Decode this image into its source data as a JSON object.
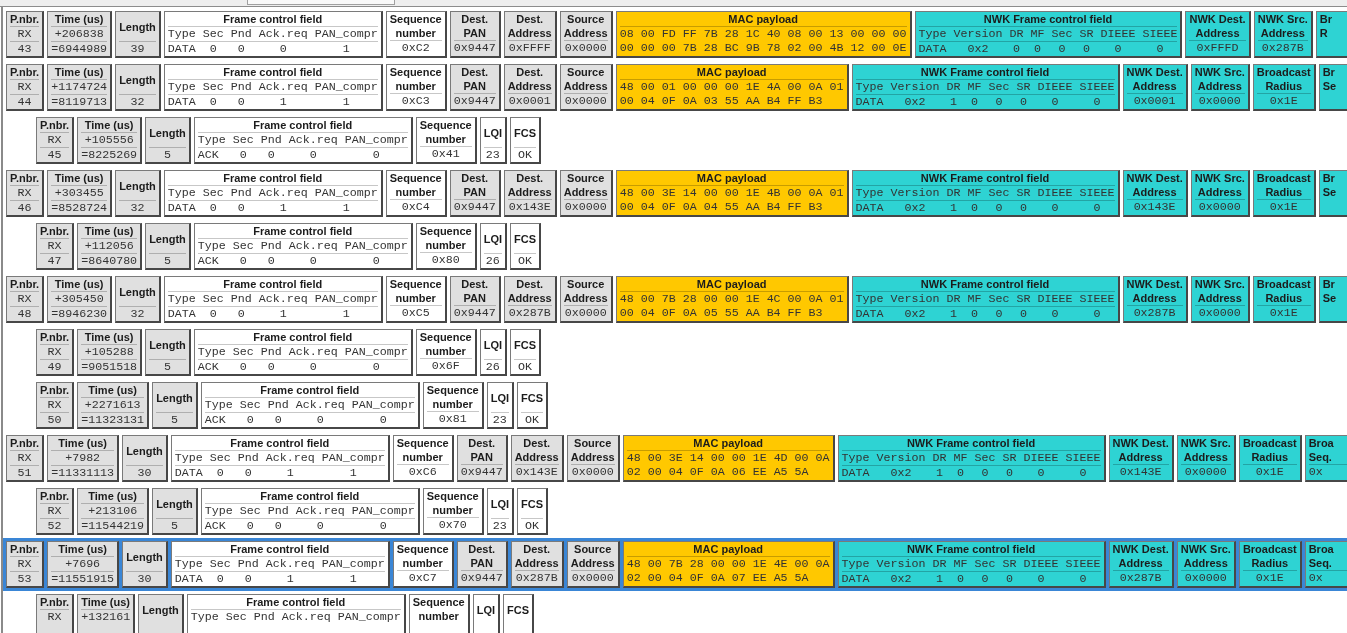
{
  "packets": [
    {
      "kind": "data",
      "selected": false,
      "fields": [
        {
          "kind": "stack",
          "color": "#e0e0e0",
          "label": [
            "P.nbr."
          ],
          "values": [
            "RX",
            "43"
          ]
        },
        {
          "kind": "stack",
          "color": "#e0e0e0",
          "label": [
            "Time (us)"
          ],
          "values": [
            "+206838",
            "=6944989"
          ]
        },
        {
          "kind": "tall",
          "color": "#e0e0e0",
          "label": [
            "Length"
          ],
          "values": [
            "39"
          ]
        },
        {
          "kind": "bits",
          "color": "#ffffff",
          "label": [
            "Frame control field"
          ],
          "bits": [
            {
              "name": "Type",
              "value": "DATA"
            },
            {
              "name": "Sec",
              "value": "0"
            },
            {
              "name": "Pnd",
              "value": "0"
            },
            {
              "name": "Ack.req",
              "value": "0"
            },
            {
              "name": "PAN_compr",
              "value": "1"
            }
          ]
        },
        {
          "kind": "stack",
          "color": "#ffffff",
          "label": [
            "Sequence",
            "number"
          ],
          "values": [
            "0xC2"
          ]
        },
        {
          "kind": "stack",
          "color": "#e0e0e0",
          "label": [
            "Dest.",
            "PAN"
          ],
          "values": [
            "0x9447"
          ]
        },
        {
          "kind": "stack",
          "color": "#e0e0e0",
          "label": [
            "Dest.",
            "Address"
          ],
          "values": [
            "0xFFFF"
          ]
        },
        {
          "kind": "stack",
          "color": "#e0e0e0",
          "label": [
            "Source",
            "Address"
          ],
          "values": [
            "0x0000"
          ]
        },
        {
          "kind": "payload",
          "color": "#ffc800",
          "label": [
            "MAC payload"
          ],
          "values": [
            "08 00 FD FF 7B 28 1C 40 08 00 13 00 00 00",
            "00 00 00 7B 28 BC 9B 78 02 00 4B 12 00 0E"
          ]
        },
        {
          "kind": "bits",
          "color": "#2ed3d3",
          "label": [
            "NWK Frame control field"
          ],
          "bits": [
            {
              "name": "Type",
              "value": "DATA"
            },
            {
              "name": "Version",
              "value": "0x2"
            },
            {
              "name": "DR",
              "value": "0"
            },
            {
              "name": "MF",
              "value": "0"
            },
            {
              "name": "Sec",
              "value": "0"
            },
            {
              "name": "SR",
              "value": "0"
            },
            {
              "name": "DIEEE",
              "value": "0"
            },
            {
              "name": "SIEEE",
              "value": "0"
            }
          ]
        },
        {
          "kind": "stack",
          "color": "#2ed3d3",
          "label": [
            "NWK Dest.",
            "Address"
          ],
          "values": [
            "0xFFFD"
          ]
        },
        {
          "kind": "stack",
          "color": "#2ed3d3",
          "label": [
            "NWK Src.",
            "Address"
          ],
          "values": [
            "0x287B"
          ]
        },
        {
          "kind": "partial",
          "color": "#2ed3d3",
          "label": [
            "Br",
            "R"
          ]
        }
      ]
    },
    {
      "kind": "data",
      "selected": false,
      "fields": [
        {
          "kind": "stack",
          "color": "#e0e0e0",
          "label": [
            "P.nbr."
          ],
          "values": [
            "RX",
            "44"
          ]
        },
        {
          "kind": "stack",
          "color": "#e0e0e0",
          "label": [
            "Time (us)"
          ],
          "values": [
            "+1174724",
            "=8119713"
          ]
        },
        {
          "kind": "tall",
          "color": "#e0e0e0",
          "label": [
            "Length"
          ],
          "values": [
            "32"
          ]
        },
        {
          "kind": "bits",
          "color": "#ffffff",
          "label": [
            "Frame control field"
          ],
          "bits": [
            {
              "name": "Type",
              "value": "DATA"
            },
            {
              "name": "Sec",
              "value": "0"
            },
            {
              "name": "Pnd",
              "value": "0"
            },
            {
              "name": "Ack.req",
              "value": "1"
            },
            {
              "name": "PAN_compr",
              "value": "1"
            }
          ]
        },
        {
          "kind": "stack",
          "color": "#ffffff",
          "label": [
            "Sequence",
            "number"
          ],
          "values": [
            "0xC3"
          ]
        },
        {
          "kind": "stack",
          "color": "#e0e0e0",
          "label": [
            "Dest.",
            "PAN"
          ],
          "values": [
            "0x9447"
          ]
        },
        {
          "kind": "stack",
          "color": "#e0e0e0",
          "label": [
            "Dest.",
            "Address"
          ],
          "values": [
            "0x0001"
          ]
        },
        {
          "kind": "stack",
          "color": "#e0e0e0",
          "label": [
            "Source",
            "Address"
          ],
          "values": [
            "0x0000"
          ]
        },
        {
          "kind": "payload",
          "color": "#ffc800",
          "label": [
            "MAC payload"
          ],
          "values": [
            "48 00 01 00 00 00 1E 4A 00 0A 01",
            "00 04 0F 0A 03 55 AA B4 FF B3"
          ]
        },
        {
          "kind": "bits",
          "color": "#2ed3d3",
          "label": [
            "NWK Frame control field"
          ],
          "bits": [
            {
              "name": "Type",
              "value": "DATA"
            },
            {
              "name": "Version",
              "value": "0x2"
            },
            {
              "name": "DR",
              "value": "1"
            },
            {
              "name": "MF",
              "value": "0"
            },
            {
              "name": "Sec",
              "value": "0"
            },
            {
              "name": "SR",
              "value": "0"
            },
            {
              "name": "DIEEE",
              "value": "0"
            },
            {
              "name": "SIEEE",
              "value": "0"
            }
          ]
        },
        {
          "kind": "stack",
          "color": "#2ed3d3",
          "label": [
            "NWK Dest.",
            "Address"
          ],
          "values": [
            "0x0001"
          ]
        },
        {
          "kind": "stack",
          "color": "#2ed3d3",
          "label": [
            "NWK Src.",
            "Address"
          ],
          "values": [
            "0x0000"
          ]
        },
        {
          "kind": "stack",
          "color": "#2ed3d3",
          "label": [
            "Broadcast",
            "Radius"
          ],
          "values": [
            "0x1E"
          ]
        },
        {
          "kind": "partial",
          "color": "#2ed3d3",
          "label": [
            "Br",
            "Se"
          ]
        }
      ]
    },
    {
      "kind": "ack",
      "selected": false,
      "fields": [
        {
          "kind": "stack",
          "color": "#e0e0e0",
          "label": [
            "P.nbr."
          ],
          "values": [
            "RX",
            "45"
          ]
        },
        {
          "kind": "stack",
          "color": "#e0e0e0",
          "label": [
            "Time (us)"
          ],
          "values": [
            "+105556",
            "=8225269"
          ]
        },
        {
          "kind": "tall",
          "color": "#e0e0e0",
          "label": [
            "Length"
          ],
          "values": [
            "5"
          ]
        },
        {
          "kind": "bits",
          "color": "#ffffff",
          "label": [
            "Frame control field"
          ],
          "bits": [
            {
              "name": "Type",
              "value": "ACK"
            },
            {
              "name": "Sec",
              "value": "0"
            },
            {
              "name": "Pnd",
              "value": "0"
            },
            {
              "name": "Ack.req",
              "value": "0"
            },
            {
              "name": "PAN_compr",
              "value": "0"
            }
          ]
        },
        {
          "kind": "stack",
          "color": "#ffffff",
          "label": [
            "Sequence",
            "number"
          ],
          "values": [
            "0x41"
          ]
        },
        {
          "kind": "tall",
          "color": "#ffffff",
          "label": [
            "LQI"
          ],
          "values": [
            "23"
          ]
        },
        {
          "kind": "tall",
          "color": "#ffffff",
          "label": [
            "FCS"
          ],
          "values": [
            "OK"
          ]
        }
      ]
    },
    {
      "kind": "data",
      "selected": false,
      "fields": [
        {
          "kind": "stack",
          "color": "#e0e0e0",
          "label": [
            "P.nbr."
          ],
          "values": [
            "RX",
            "46"
          ]
        },
        {
          "kind": "stack",
          "color": "#e0e0e0",
          "label": [
            "Time (us)"
          ],
          "values": [
            "+303455",
            "=8528724"
          ]
        },
        {
          "kind": "tall",
          "color": "#e0e0e0",
          "label": [
            "Length"
          ],
          "values": [
            "32"
          ]
        },
        {
          "kind": "bits",
          "color": "#ffffff",
          "label": [
            "Frame control field"
          ],
          "bits": [
            {
              "name": "Type",
              "value": "DATA"
            },
            {
              "name": "Sec",
              "value": "0"
            },
            {
              "name": "Pnd",
              "value": "0"
            },
            {
              "name": "Ack.req",
              "value": "1"
            },
            {
              "name": "PAN_compr",
              "value": "1"
            }
          ]
        },
        {
          "kind": "stack",
          "color": "#ffffff",
          "label": [
            "Sequence",
            "number"
          ],
          "values": [
            "0xC4"
          ]
        },
        {
          "kind": "stack",
          "color": "#e0e0e0",
          "label": [
            "Dest.",
            "PAN"
          ],
          "values": [
            "0x9447"
          ]
        },
        {
          "kind": "stack",
          "color": "#e0e0e0",
          "label": [
            "Dest.",
            "Address"
          ],
          "values": [
            "0x143E"
          ]
        },
        {
          "kind": "stack",
          "color": "#e0e0e0",
          "label": [
            "Source",
            "Address"
          ],
          "values": [
            "0x0000"
          ]
        },
        {
          "kind": "payload",
          "color": "#ffc800",
          "label": [
            "MAC payload"
          ],
          "values": [
            "48 00 3E 14 00 00 1E 4B 00 0A 01",
            "00 04 0F 0A 04 55 AA B4 FF B3"
          ]
        },
        {
          "kind": "bits",
          "color": "#2ed3d3",
          "label": [
            "NWK Frame control field"
          ],
          "bits": [
            {
              "name": "Type",
              "value": "DATA"
            },
            {
              "name": "Version",
              "value": "0x2"
            },
            {
              "name": "DR",
              "value": "1"
            },
            {
              "name": "MF",
              "value": "0"
            },
            {
              "name": "Sec",
              "value": "0"
            },
            {
              "name": "SR",
              "value": "0"
            },
            {
              "name": "DIEEE",
              "value": "0"
            },
            {
              "name": "SIEEE",
              "value": "0"
            }
          ]
        },
        {
          "kind": "stack",
          "color": "#2ed3d3",
          "label": [
            "NWK Dest.",
            "Address"
          ],
          "values": [
            "0x143E"
          ]
        },
        {
          "kind": "stack",
          "color": "#2ed3d3",
          "label": [
            "NWK Src.",
            "Address"
          ],
          "values": [
            "0x0000"
          ]
        },
        {
          "kind": "stack",
          "color": "#2ed3d3",
          "label": [
            "Broadcast",
            "Radius"
          ],
          "values": [
            "0x1E"
          ]
        },
        {
          "kind": "partial",
          "color": "#2ed3d3",
          "label": [
            "Br",
            "Se"
          ]
        }
      ]
    },
    {
      "kind": "ack",
      "selected": false,
      "fields": [
        {
          "kind": "stack",
          "color": "#e0e0e0",
          "label": [
            "P.nbr."
          ],
          "values": [
            "RX",
            "47"
          ]
        },
        {
          "kind": "stack",
          "color": "#e0e0e0",
          "label": [
            "Time (us)"
          ],
          "values": [
            "+112056",
            "=8640780"
          ]
        },
        {
          "kind": "tall",
          "color": "#e0e0e0",
          "label": [
            "Length"
          ],
          "values": [
            "5"
          ]
        },
        {
          "kind": "bits",
          "color": "#ffffff",
          "label": [
            "Frame control field"
          ],
          "bits": [
            {
              "name": "Type",
              "value": "ACK"
            },
            {
              "name": "Sec",
              "value": "0"
            },
            {
              "name": "Pnd",
              "value": "0"
            },
            {
              "name": "Ack.req",
              "value": "0"
            },
            {
              "name": "PAN_compr",
              "value": "0"
            }
          ]
        },
        {
          "kind": "stack",
          "color": "#ffffff",
          "label": [
            "Sequence",
            "number"
          ],
          "values": [
            "0x80"
          ]
        },
        {
          "kind": "tall",
          "color": "#ffffff",
          "label": [
            "LQI"
          ],
          "values": [
            "26"
          ]
        },
        {
          "kind": "tall",
          "color": "#ffffff",
          "label": [
            "FCS"
          ],
          "values": [
            "OK"
          ]
        }
      ]
    },
    {
      "kind": "data",
      "selected": false,
      "fields": [
        {
          "kind": "stack",
          "color": "#e0e0e0",
          "label": [
            "P.nbr."
          ],
          "values": [
            "RX",
            "48"
          ]
        },
        {
          "kind": "stack",
          "color": "#e0e0e0",
          "label": [
            "Time (us)"
          ],
          "values": [
            "+305450",
            "=8946230"
          ]
        },
        {
          "kind": "tall",
          "color": "#e0e0e0",
          "label": [
            "Length"
          ],
          "values": [
            "32"
          ]
        },
        {
          "kind": "bits",
          "color": "#ffffff",
          "label": [
            "Frame control field"
          ],
          "bits": [
            {
              "name": "Type",
              "value": "DATA"
            },
            {
              "name": "Sec",
              "value": "0"
            },
            {
              "name": "Pnd",
              "value": "0"
            },
            {
              "name": "Ack.req",
              "value": "1"
            },
            {
              "name": "PAN_compr",
              "value": "1"
            }
          ]
        },
        {
          "kind": "stack",
          "color": "#ffffff",
          "label": [
            "Sequence",
            "number"
          ],
          "values": [
            "0xC5"
          ]
        },
        {
          "kind": "stack",
          "color": "#e0e0e0",
          "label": [
            "Dest.",
            "PAN"
          ],
          "values": [
            "0x9447"
          ]
        },
        {
          "kind": "stack",
          "color": "#e0e0e0",
          "label": [
            "Dest.",
            "Address"
          ],
          "values": [
            "0x287B"
          ]
        },
        {
          "kind": "stack",
          "color": "#e0e0e0",
          "label": [
            "Source",
            "Address"
          ],
          "values": [
            "0x0000"
          ]
        },
        {
          "kind": "payload",
          "color": "#ffc800",
          "label": [
            "MAC payload"
          ],
          "values": [
            "48 00 7B 28 00 00 1E 4C 00 0A 01",
            "00 04 0F 0A 05 55 AA B4 FF B3"
          ]
        },
        {
          "kind": "bits",
          "color": "#2ed3d3",
          "label": [
            "NWK Frame control field"
          ],
          "bits": [
            {
              "name": "Type",
              "value": "DATA"
            },
            {
              "name": "Version",
              "value": "0x2"
            },
            {
              "name": "DR",
              "value": "1"
            },
            {
              "name": "MF",
              "value": "0"
            },
            {
              "name": "Sec",
              "value": "0"
            },
            {
              "name": "SR",
              "value": "0"
            },
            {
              "name": "DIEEE",
              "value": "0"
            },
            {
              "name": "SIEEE",
              "value": "0"
            }
          ]
        },
        {
          "kind": "stack",
          "color": "#2ed3d3",
          "label": [
            "NWK Dest.",
            "Address"
          ],
          "values": [
            "0x287B"
          ]
        },
        {
          "kind": "stack",
          "color": "#2ed3d3",
          "label": [
            "NWK Src.",
            "Address"
          ],
          "values": [
            "0x0000"
          ]
        },
        {
          "kind": "stack",
          "color": "#2ed3d3",
          "label": [
            "Broadcast",
            "Radius"
          ],
          "values": [
            "0x1E"
          ]
        },
        {
          "kind": "partial",
          "color": "#2ed3d3",
          "label": [
            "Br",
            "Se"
          ]
        }
      ]
    },
    {
      "kind": "ack",
      "selected": false,
      "fields": [
        {
          "kind": "stack",
          "color": "#e0e0e0",
          "label": [
            "P.nbr."
          ],
          "values": [
            "RX",
            "49"
          ]
        },
        {
          "kind": "stack",
          "color": "#e0e0e0",
          "label": [
            "Time (us)"
          ],
          "values": [
            "+105288",
            "=9051518"
          ]
        },
        {
          "kind": "tall",
          "color": "#e0e0e0",
          "label": [
            "Length"
          ],
          "values": [
            "5"
          ]
        },
        {
          "kind": "bits",
          "color": "#ffffff",
          "label": [
            "Frame control field"
          ],
          "bits": [
            {
              "name": "Type",
              "value": "ACK"
            },
            {
              "name": "Sec",
              "value": "0"
            },
            {
              "name": "Pnd",
              "value": "0"
            },
            {
              "name": "Ack.req",
              "value": "0"
            },
            {
              "name": "PAN_compr",
              "value": "0"
            }
          ]
        },
        {
          "kind": "stack",
          "color": "#ffffff",
          "label": [
            "Sequence",
            "number"
          ],
          "values": [
            "0x6F"
          ]
        },
        {
          "kind": "tall",
          "color": "#ffffff",
          "label": [
            "LQI"
          ],
          "values": [
            "26"
          ]
        },
        {
          "kind": "tall",
          "color": "#ffffff",
          "label": [
            "FCS"
          ],
          "values": [
            "OK"
          ]
        }
      ]
    },
    {
      "kind": "ack",
      "selected": false,
      "fields": [
        {
          "kind": "stack",
          "color": "#e0e0e0",
          "label": [
            "P.nbr."
          ],
          "values": [
            "RX",
            "50"
          ]
        },
        {
          "kind": "stack",
          "color": "#e0e0e0",
          "label": [
            "Time (us)"
          ],
          "values": [
            "+2271613",
            "=11323131"
          ]
        },
        {
          "kind": "tall",
          "color": "#e0e0e0",
          "label": [
            "Length"
          ],
          "values": [
            "5"
          ]
        },
        {
          "kind": "bits",
          "color": "#ffffff",
          "label": [
            "Frame control field"
          ],
          "bits": [
            {
              "name": "Type",
              "value": "ACK"
            },
            {
              "name": "Sec",
              "value": "0"
            },
            {
              "name": "Pnd",
              "value": "0"
            },
            {
              "name": "Ack.req",
              "value": "0"
            },
            {
              "name": "PAN_compr",
              "value": "0"
            }
          ]
        },
        {
          "kind": "stack",
          "color": "#ffffff",
          "label": [
            "Sequence",
            "number"
          ],
          "values": [
            "0x81"
          ]
        },
        {
          "kind": "tall",
          "color": "#ffffff",
          "label": [
            "LQI"
          ],
          "values": [
            "23"
          ]
        },
        {
          "kind": "tall",
          "color": "#ffffff",
          "label": [
            "FCS"
          ],
          "values": [
            "OK"
          ]
        }
      ]
    },
    {
      "kind": "data",
      "selected": false,
      "fields": [
        {
          "kind": "stack",
          "color": "#e0e0e0",
          "label": [
            "P.nbr."
          ],
          "values": [
            "RX",
            "51"
          ]
        },
        {
          "kind": "stack",
          "color": "#e0e0e0",
          "label": [
            "Time (us)"
          ],
          "values": [
            "+7982",
            "=11331113"
          ]
        },
        {
          "kind": "tall",
          "color": "#e0e0e0",
          "label": [
            "Length"
          ],
          "values": [
            "30"
          ]
        },
        {
          "kind": "bits",
          "color": "#ffffff",
          "label": [
            "Frame control field"
          ],
          "bits": [
            {
              "name": "Type",
              "value": "DATA"
            },
            {
              "name": "Sec",
              "value": "0"
            },
            {
              "name": "Pnd",
              "value": "0"
            },
            {
              "name": "Ack.req",
              "value": "1"
            },
            {
              "name": "PAN_compr",
              "value": "1"
            }
          ]
        },
        {
          "kind": "stack",
          "color": "#ffffff",
          "label": [
            "Sequence",
            "number"
          ],
          "values": [
            "0xC6"
          ]
        },
        {
          "kind": "stack",
          "color": "#e0e0e0",
          "label": [
            "Dest.",
            "PAN"
          ],
          "values": [
            "0x9447"
          ]
        },
        {
          "kind": "stack",
          "color": "#e0e0e0",
          "label": [
            "Dest.",
            "Address"
          ],
          "values": [
            "0x143E"
          ]
        },
        {
          "kind": "stack",
          "color": "#e0e0e0",
          "label": [
            "Source",
            "Address"
          ],
          "values": [
            "0x0000"
          ]
        },
        {
          "kind": "payload",
          "color": "#ffc800",
          "label": [
            "MAC payload"
          ],
          "values": [
            "48 00 3E 14 00 00 1E 4D 00 0A",
            "02 00 04 0F 0A 06 EE A5 5A"
          ]
        },
        {
          "kind": "bits",
          "color": "#2ed3d3",
          "label": [
            "NWK Frame control field"
          ],
          "bits": [
            {
              "name": "Type",
              "value": "DATA"
            },
            {
              "name": "Version",
              "value": "0x2"
            },
            {
              "name": "DR",
              "value": "1"
            },
            {
              "name": "MF",
              "value": "0"
            },
            {
              "name": "Sec",
              "value": "0"
            },
            {
              "name": "SR",
              "value": "0"
            },
            {
              "name": "DIEEE",
              "value": "0"
            },
            {
              "name": "SIEEE",
              "value": "0"
            }
          ]
        },
        {
          "kind": "stack",
          "color": "#2ed3d3",
          "label": [
            "NWK Dest.",
            "Address"
          ],
          "values": [
            "0x143E"
          ]
        },
        {
          "kind": "stack",
          "color": "#2ed3d3",
          "label": [
            "NWK Src.",
            "Address"
          ],
          "values": [
            "0x0000"
          ]
        },
        {
          "kind": "stack",
          "color": "#2ed3d3",
          "label": [
            "Broadcast",
            "Radius"
          ],
          "values": [
            "0x1E"
          ]
        },
        {
          "kind": "partial",
          "color": "#2ed3d3",
          "label": [
            "Broa",
            "Seq."
          ],
          "values": [
            "0x"
          ]
        }
      ]
    },
    {
      "kind": "ack",
      "selected": false,
      "fields": [
        {
          "kind": "stack",
          "color": "#e0e0e0",
          "label": [
            "P.nbr."
          ],
          "values": [
            "RX",
            "52"
          ]
        },
        {
          "kind": "stack",
          "color": "#e0e0e0",
          "label": [
            "Time (us)"
          ],
          "values": [
            "+213106",
            "=11544219"
          ]
        },
        {
          "kind": "tall",
          "color": "#e0e0e0",
          "label": [
            "Length"
          ],
          "values": [
            "5"
          ]
        },
        {
          "kind": "bits",
          "color": "#ffffff",
          "label": [
            "Frame control field"
          ],
          "bits": [
            {
              "name": "Type",
              "value": "ACK"
            },
            {
              "name": "Sec",
              "value": "0"
            },
            {
              "name": "Pnd",
              "value": "0"
            },
            {
              "name": "Ack.req",
              "value": "0"
            },
            {
              "name": "PAN_compr",
              "value": "0"
            }
          ]
        },
        {
          "kind": "stack",
          "color": "#ffffff",
          "label": [
            "Sequence",
            "number"
          ],
          "values": [
            "0x70"
          ]
        },
        {
          "kind": "tall",
          "color": "#ffffff",
          "label": [
            "LQI"
          ],
          "values": [
            "23"
          ]
        },
        {
          "kind": "tall",
          "color": "#ffffff",
          "label": [
            "FCS"
          ],
          "values": [
            "OK"
          ]
        }
      ]
    },
    {
      "kind": "data",
      "selected": true,
      "fields": [
        {
          "kind": "stack",
          "color": "#e0e0e0",
          "label": [
            "P.nbr."
          ],
          "values": [
            "RX",
            "53"
          ]
        },
        {
          "kind": "stack",
          "color": "#e0e0e0",
          "label": [
            "Time (us)"
          ],
          "values": [
            "+7696",
            "=11551915"
          ]
        },
        {
          "kind": "tall",
          "color": "#e0e0e0",
          "label": [
            "Length"
          ],
          "values": [
            "30"
          ]
        },
        {
          "kind": "bits",
          "color": "#ffffff",
          "label": [
            "Frame control field"
          ],
          "bits": [
            {
              "name": "Type",
              "value": "DATA"
            },
            {
              "name": "Sec",
              "value": "0"
            },
            {
              "name": "Pnd",
              "value": "0"
            },
            {
              "name": "Ack.req",
              "value": "1"
            },
            {
              "name": "PAN_compr",
              "value": "1"
            }
          ]
        },
        {
          "kind": "stack",
          "color": "#ffffff",
          "label": [
            "Sequence",
            "number"
          ],
          "values": [
            "0xC7"
          ]
        },
        {
          "kind": "stack",
          "color": "#e0e0e0",
          "label": [
            "Dest.",
            "PAN"
          ],
          "values": [
            "0x9447"
          ]
        },
        {
          "kind": "stack",
          "color": "#e0e0e0",
          "label": [
            "Dest.",
            "Address"
          ],
          "values": [
            "0x287B"
          ]
        },
        {
          "kind": "stack",
          "color": "#e0e0e0",
          "label": [
            "Source",
            "Address"
          ],
          "values": [
            "0x0000"
          ]
        },
        {
          "kind": "payload",
          "color": "#ffc800",
          "label": [
            "MAC payload"
          ],
          "values": [
            "48 00 7B 28 00 00 1E 4E 00 0A",
            "02 00 04 0F 0A 07 EE A5 5A"
          ]
        },
        {
          "kind": "bits",
          "color": "#2ed3d3",
          "label": [
            "NWK Frame control field"
          ],
          "bits": [
            {
              "name": "Type",
              "value": "DATA"
            },
            {
              "name": "Version",
              "value": "0x2"
            },
            {
              "name": "DR",
              "value": "1"
            },
            {
              "name": "MF",
              "value": "0"
            },
            {
              "name": "Sec",
              "value": "0"
            },
            {
              "name": "SR",
              "value": "0"
            },
            {
              "name": "DIEEE",
              "value": "0"
            },
            {
              "name": "SIEEE",
              "value": "0"
            }
          ]
        },
        {
          "kind": "stack",
          "color": "#2ed3d3",
          "label": [
            "NWK Dest.",
            "Address"
          ],
          "values": [
            "0x287B"
          ]
        },
        {
          "kind": "stack",
          "color": "#2ed3d3",
          "label": [
            "NWK Src.",
            "Address"
          ],
          "values": [
            "0x0000"
          ]
        },
        {
          "kind": "stack",
          "color": "#2ed3d3",
          "label": [
            "Broadcast",
            "Radius"
          ],
          "values": [
            "0x1E"
          ]
        },
        {
          "kind": "partial",
          "color": "#2ed3d3",
          "label": [
            "Broa",
            "Seq."
          ],
          "values": [
            "0x"
          ]
        }
      ]
    },
    {
      "kind": "ack",
      "selected": false,
      "fields": [
        {
          "kind": "stack",
          "color": "#e0e0e0",
          "label": [
            "P.nbr."
          ],
          "values": [
            "RX"
          ]
        },
        {
          "kind": "stack",
          "color": "#e0e0e0",
          "label": [
            "Time (us)"
          ],
          "values": [
            "+132161"
          ]
        },
        {
          "kind": "tall",
          "color": "#e0e0e0",
          "label": [
            "Length"
          ]
        },
        {
          "kind": "bits",
          "color": "#ffffff",
          "label": [
            "Frame control field"
          ],
          "bits": [
            {
              "name": "Type"
            },
            {
              "name": "Sec"
            },
            {
              "name": "Pnd"
            },
            {
              "name": "Ack.req"
            },
            {
              "name": "PAN_compr"
            }
          ]
        },
        {
          "kind": "stack",
          "color": "#ffffff",
          "label": [
            "Sequence",
            "number"
          ]
        },
        {
          "kind": "tall",
          "color": "#ffffff",
          "label": [
            "LQI"
          ]
        },
        {
          "kind": "tall",
          "color": "#ffffff",
          "label": [
            "FCS"
          ]
        }
      ]
    }
  ]
}
